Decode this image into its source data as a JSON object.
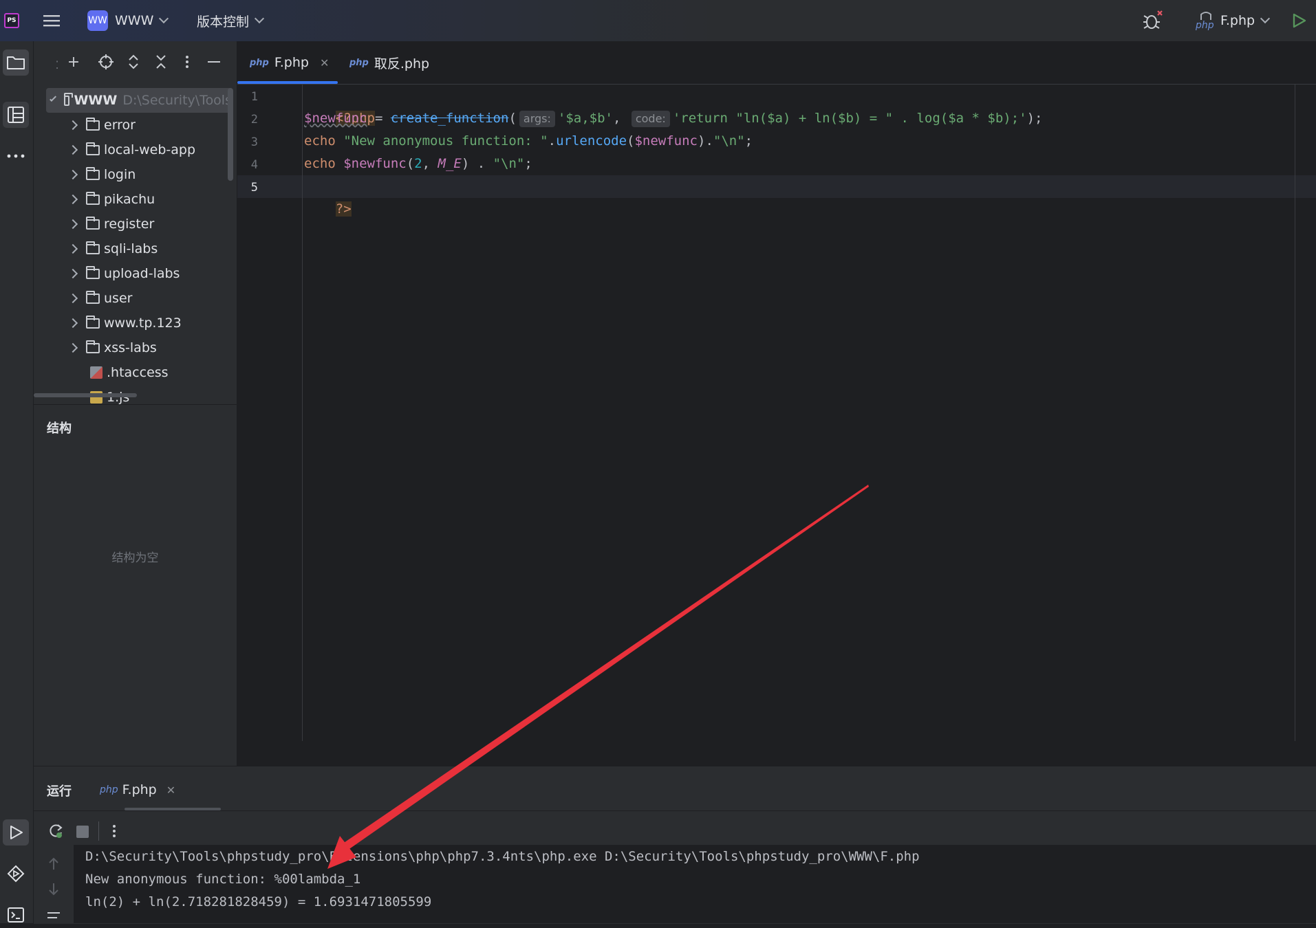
{
  "titlebar": {
    "project_badge": "WW",
    "project_name": "WWW",
    "vcs_label": "版本控制",
    "run_config": "F.php",
    "run_config_badge": "php"
  },
  "project_panel": {
    "root_name": "WWW",
    "root_path": "D:\\Security\\Tools",
    "items": [
      {
        "label": "error",
        "type": "folder"
      },
      {
        "label": "local-web-app",
        "type": "folder"
      },
      {
        "label": "login",
        "type": "folder"
      },
      {
        "label": "pikachu",
        "type": "folder"
      },
      {
        "label": "register",
        "type": "folder"
      },
      {
        "label": "sqli-labs",
        "type": "folder"
      },
      {
        "label": "upload-labs",
        "type": "folder"
      },
      {
        "label": "user",
        "type": "folder"
      },
      {
        "label": "www.tp.123",
        "type": "folder"
      },
      {
        "label": "xss-labs",
        "type": "folder"
      },
      {
        "label": ".htaccess",
        "type": "file"
      },
      {
        "label": "1.js",
        "type": "file"
      }
    ]
  },
  "structure": {
    "title": "结构",
    "empty_text": "结构为空"
  },
  "editor": {
    "tabs": [
      {
        "badge": "php",
        "label": "F.php",
        "active": true
      },
      {
        "badge": "php",
        "label": "取反.php",
        "active": false
      }
    ],
    "line_numbers": [
      "1",
      "2",
      "3",
      "4",
      "5"
    ],
    "code": {
      "l1": "<?php",
      "l2_var": "$newfunc",
      "l2_eq": " = ",
      "l2_fn": "create_function",
      "l2_paren": "(",
      "l2_hint_args": "args:",
      "l2_arg1": "'$a,$b'",
      "l2_comma": ", ",
      "l2_hint_code": "code:",
      "l2_arg2": "'return \"ln($a) + ln($b) = \" . log($a * $b);'",
      "l2_end": ");",
      "l3_echo": "echo ",
      "l3_str": "\"New anonymous function: \"",
      "l3_dot": ".",
      "l3_fn": "urlencode",
      "l3_open": "(",
      "l3_var": "$newfunc",
      "l3_close": ").",
      "l3_str2": "\"\\n\"",
      "l3_end": ";",
      "l4_echo": "echo ",
      "l4_var": "$newfunc",
      "l4_open": "(",
      "l4_num": "2",
      "l4_comma": ", ",
      "l4_const": "M_E",
      "l4_close": ") . ",
      "l4_str": "\"\\n\"",
      "l4_end": ";",
      "l5": "?>"
    }
  },
  "run_panel": {
    "title": "运行",
    "tab_badge": "php",
    "tab_label": "F.php",
    "console_lines": [
      "D:\\Security\\Tools\\phpstudy_pro\\Extensions\\php\\php7.3.4nts\\php.exe D:\\Security\\Tools\\phpstudy_pro\\WWW\\F.php",
      "New anonymous function: %00lambda_1",
      "ln(2) + ln(2.718281828459) = 1.6931471805599"
    ]
  },
  "colors": {
    "accent_blue": "#3574f0",
    "run_green": "#57965c",
    "annotation_arrow": "#e8313b"
  }
}
